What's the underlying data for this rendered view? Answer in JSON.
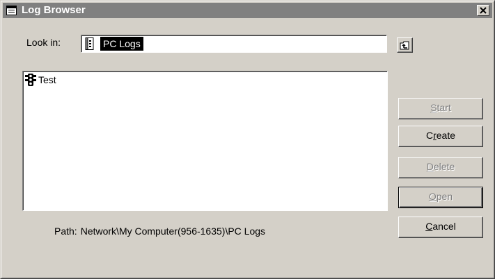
{
  "window": {
    "title": "Log Browser",
    "title_icon": "window-icon",
    "close_icon": "close-icon"
  },
  "look_in": {
    "label": "Look in:",
    "selected": "PC Logs",
    "icon": "log-folder-icon"
  },
  "up_folder_icon": "up-folder-icon",
  "log_list": {
    "items": [
      {
        "label": "Test",
        "icon": "traffic-light-icon"
      }
    ]
  },
  "buttons": {
    "start": {
      "mnemonic": "S",
      "rest": "tart",
      "enabled": false
    },
    "create": {
      "pre": "C",
      "mnemonic": "r",
      "rest": "eate",
      "enabled": true
    },
    "delete": {
      "mnemonic": "D",
      "rest": "elete",
      "enabled": false
    },
    "open": {
      "mnemonic": "O",
      "rest": "pen",
      "enabled": false,
      "default": true
    },
    "cancel": {
      "mnemonic": "C",
      "rest": "ancel",
      "enabled": true
    }
  },
  "path": {
    "label": "Path:",
    "value": "Network\\My Computer(956-1635)\\PC Logs"
  },
  "colors": {
    "face": "#d4d0c8",
    "titlebar": "#808080",
    "selection": "#000000",
    "disabled_text": "#808080"
  }
}
